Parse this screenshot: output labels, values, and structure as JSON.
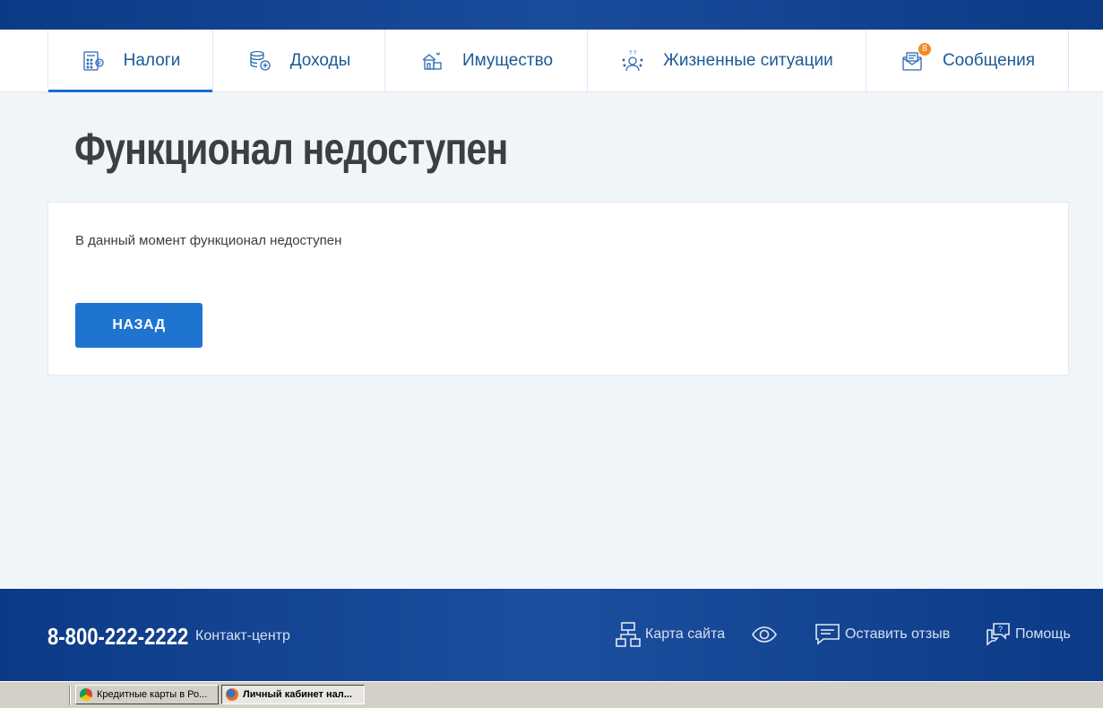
{
  "nav": {
    "tabs": [
      {
        "label": "Налоги",
        "icon": "calculator-icon",
        "active": true
      },
      {
        "label": "Доходы",
        "icon": "coins-icon"
      },
      {
        "label": "Имущество",
        "icon": "property-icon"
      },
      {
        "label": "Жизненные ситуации",
        "icon": "person-question-icon"
      },
      {
        "label": "Сообщения",
        "icon": "envelope-icon",
        "badge": "8"
      }
    ]
  },
  "main": {
    "title": "Функционал недоступен",
    "message": "В данный момент функционал недоступен",
    "back_label": "НАЗАД"
  },
  "footer": {
    "phone": "8-800-222-2222",
    "contact": "Контакт-центр",
    "links": [
      {
        "label": "Карта сайта",
        "icon": "sitemap-icon"
      },
      {
        "label": "",
        "icon": "eye-icon"
      },
      {
        "label": "Оставить отзыв",
        "icon": "feedback-icon"
      },
      {
        "label": "Помощь",
        "icon": "help-icon"
      }
    ]
  },
  "taskbar": {
    "items": [
      {
        "label": "Кредитные карты в Ро...",
        "icon": "chrome-icon"
      },
      {
        "label": "Личный кабинет нал...",
        "icon": "firefox-icon",
        "active": true
      }
    ]
  },
  "colors": {
    "accent": "#1e74cf",
    "nav_text": "#1b5a97",
    "badge": "#f08a24",
    "footer": "#0c3a86"
  }
}
